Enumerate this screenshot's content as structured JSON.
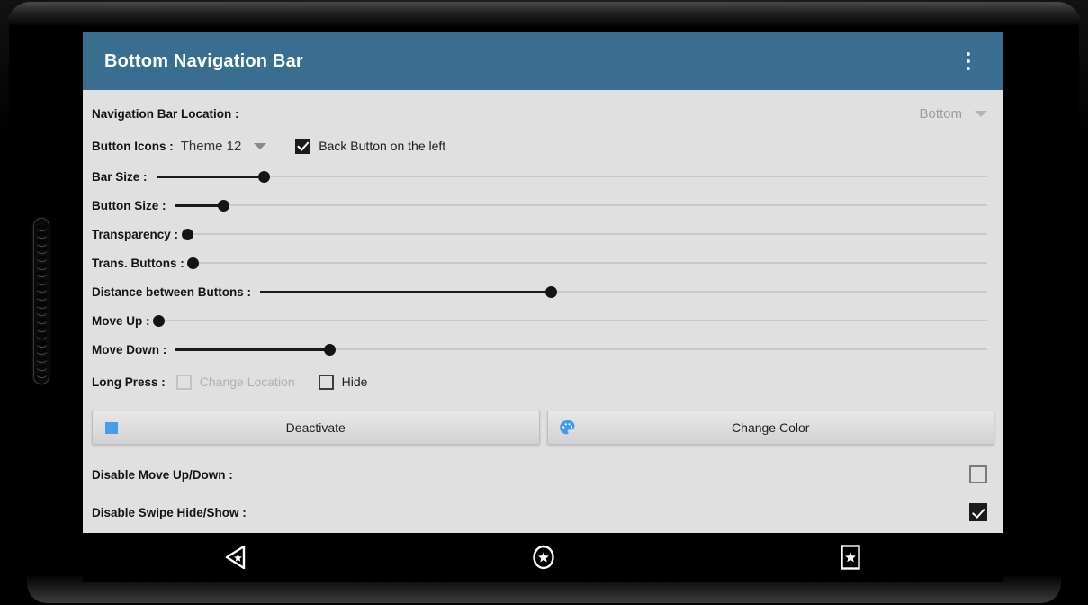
{
  "app": {
    "title": "Bottom Navigation Bar",
    "header_color": "#3a6e91",
    "body_color": "#e0e0e0",
    "overflow_menu_label": "More options"
  },
  "settings": {
    "location": {
      "label": "Navigation Bar Location :",
      "value": "Bottom",
      "disabled": true
    },
    "button_icons": {
      "label": "Button Icons :",
      "value": "Theme 12",
      "back_button_left": {
        "label": "Back Button on the left",
        "checked": true
      }
    },
    "sliders": [
      {
        "label": "Bar Size :",
        "percent": 13
      },
      {
        "label": "Button Size :",
        "percent": 6
      },
      {
        "label": "Transparency :",
        "percent": 0
      },
      {
        "label": "Trans. Buttons :",
        "percent": 0
      },
      {
        "label": "Distance between Buttons :",
        "percent": 40
      },
      {
        "label": "Move Up :",
        "percent": 0
      },
      {
        "label": "Move Down :",
        "percent": 19
      }
    ],
    "long_press": {
      "label": "Long Press :",
      "options": [
        {
          "label": "Change Location",
          "checked": false,
          "disabled": true
        },
        {
          "label": "Hide",
          "checked": false,
          "disabled": false
        }
      ]
    },
    "actions": {
      "deactivate": {
        "label": "Deactivate",
        "icon": "blue-square-icon",
        "swatch_color": "#4a9bee"
      },
      "change_color": {
        "label": "Change Color",
        "icon": "palette-icon",
        "icon_color": "#3e9bf0"
      }
    },
    "toggles": [
      {
        "label": "Disable Move Up/Down :",
        "checked": false
      },
      {
        "label": "Disable Swipe Hide/Show :",
        "checked": true
      }
    ]
  },
  "system_nav": {
    "buttons": [
      {
        "name": "back-button",
        "icon": "back-triangle-star-icon"
      },
      {
        "name": "home-button",
        "icon": "circle-star-icon"
      },
      {
        "name": "recents-button",
        "icon": "square-star-icon"
      }
    ]
  }
}
